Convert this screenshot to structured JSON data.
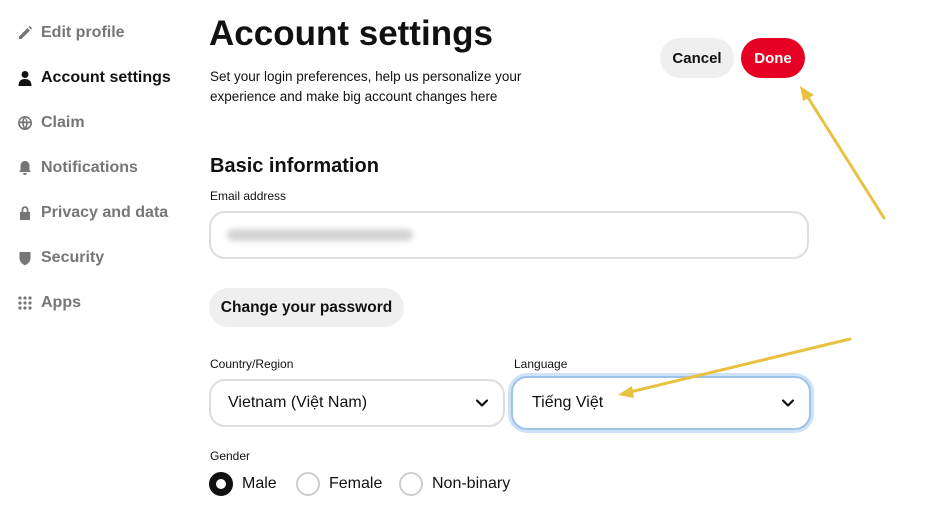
{
  "sidebar": {
    "items": [
      {
        "label": "Edit profile",
        "icon": "pencil-icon"
      },
      {
        "label": "Account settings",
        "icon": "person-icon",
        "active": true
      },
      {
        "label": "Claim",
        "icon": "globe-icon"
      },
      {
        "label": "Notifications",
        "icon": "bell-icon"
      },
      {
        "label": "Privacy and data",
        "icon": "lock-icon"
      },
      {
        "label": "Security",
        "icon": "shield-icon"
      },
      {
        "label": "Apps",
        "icon": "grid-icon"
      }
    ]
  },
  "header": {
    "title": "Account settings",
    "subtitle": "Set your login preferences, help us personalize your experience and make big account changes here"
  },
  "actions": {
    "cancel_label": "Cancel",
    "done_label": "Done"
  },
  "basic_info": {
    "section_title": "Basic information",
    "email_label": "Email address",
    "change_password_label": "Change your password",
    "country_label": "Country/Region",
    "country_value": "Vietnam (Việt Nam)",
    "language_label": "Language",
    "language_value": "Tiếng Việt",
    "gender_label": "Gender",
    "gender_options": [
      {
        "label": "Male",
        "checked": true
      },
      {
        "label": "Female",
        "checked": false
      },
      {
        "label": "Non-binary",
        "checked": false
      }
    ]
  },
  "colors": {
    "accent_red": "#e60023",
    "annotation_arrow": "#e8c140",
    "focus_ring": "#9ec3ea"
  }
}
